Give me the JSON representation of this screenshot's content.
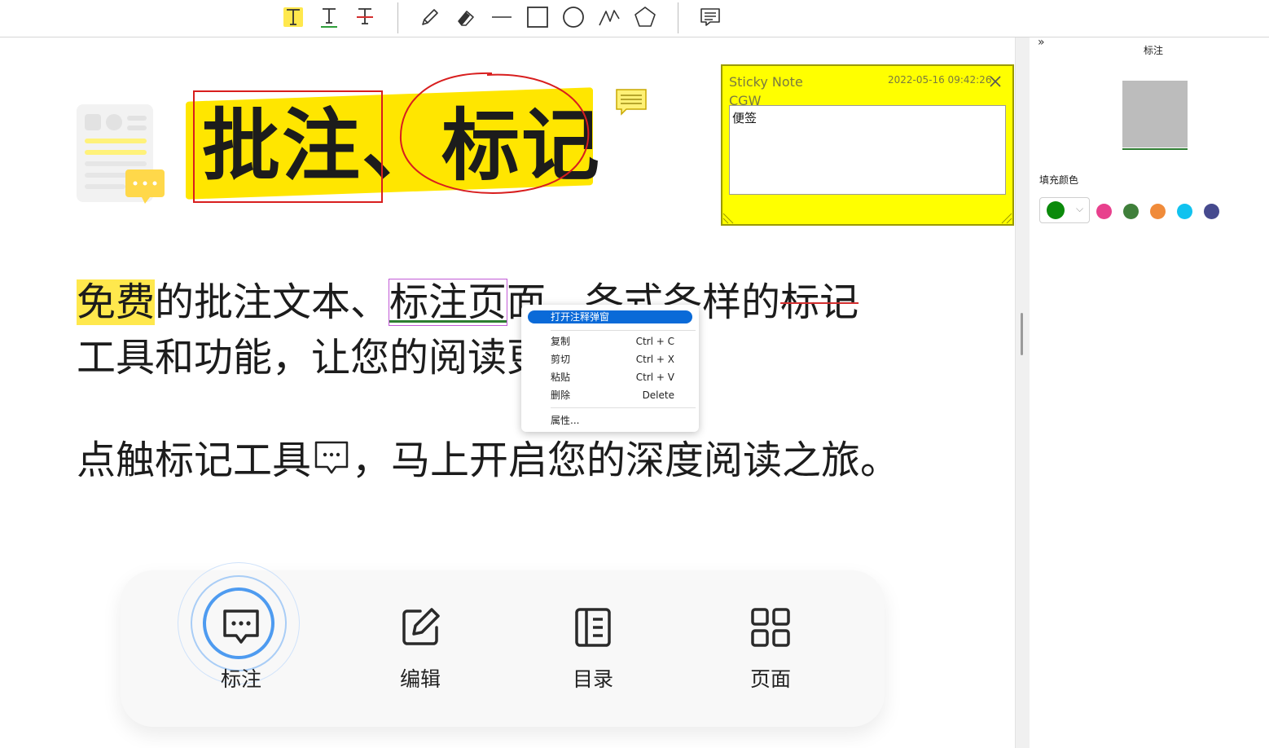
{
  "colors": {
    "accent_yellow": "#ffe600",
    "annotation_red": "#d81e1e",
    "menu_highlight": "#0a6ad8",
    "nav_ring_blue": "#4e9bf0"
  },
  "toolbar": {
    "tools": [
      {
        "name": "highlight-text-tool",
        "icon": "text-highlight-icon",
        "active": true
      },
      {
        "name": "underline-text-tool",
        "icon": "text-underline-icon"
      },
      {
        "name": "strikeout-text-tool",
        "icon": "text-strikeout-icon"
      },
      {
        "name": "pencil-tool",
        "icon": "pencil-icon"
      },
      {
        "name": "eraser-tool",
        "icon": "eraser-icon"
      },
      {
        "name": "line-tool",
        "icon": "line-icon"
      },
      {
        "name": "rectangle-tool",
        "icon": "rectangle-icon"
      },
      {
        "name": "circle-tool",
        "icon": "circle-icon"
      },
      {
        "name": "polyline-tool",
        "icon": "polyline-icon"
      },
      {
        "name": "polygon-tool",
        "icon": "polygon-icon"
      },
      {
        "name": "note-tool",
        "icon": "note-icon"
      }
    ]
  },
  "document": {
    "title": "批注、标记",
    "para1": {
      "highlight": "免费",
      "text_a": "的批注文本、",
      "underlined": "标注页",
      "text_b": "面，各式各样的",
      "struck": "标记"
    },
    "para2": "工具和功能，让您的阅读更进一步。",
    "para3_a": "点触标记工具",
    "para3_b": "，马上开启您的深度阅读之旅。"
  },
  "sticky_note": {
    "title": "Sticky Note",
    "author": "CGW",
    "timestamp": "2022-05-16 09:42:26",
    "content": "便签"
  },
  "context_menu": {
    "items": [
      {
        "label": "打开注释弹窗",
        "shortcut": ""
      },
      {
        "label": "复制",
        "shortcut": "Ctrl + C"
      },
      {
        "label": "剪切",
        "shortcut": "Ctrl + X"
      },
      {
        "label": "粘贴",
        "shortcut": "Ctrl + V"
      },
      {
        "label": "删除",
        "shortcut": "Delete"
      },
      {
        "label": "属性...",
        "shortcut": ""
      }
    ]
  },
  "bottom_nav": {
    "items": [
      {
        "label": "标注",
        "icon": "comment-icon",
        "active": true
      },
      {
        "label": "编辑",
        "icon": "edit-icon"
      },
      {
        "label": "目录",
        "icon": "toc-icon"
      },
      {
        "label": "页面",
        "icon": "pages-grid-icon"
      }
    ]
  },
  "right_panel": {
    "expand": "»",
    "title": "标注",
    "fill_color_label": "填充颜色",
    "selected_color": "#0b8a0b",
    "swatches": [
      "#e8408d",
      "#3f7f3a",
      "#f08b3a",
      "#11c2ef",
      "#464a8e"
    ]
  }
}
